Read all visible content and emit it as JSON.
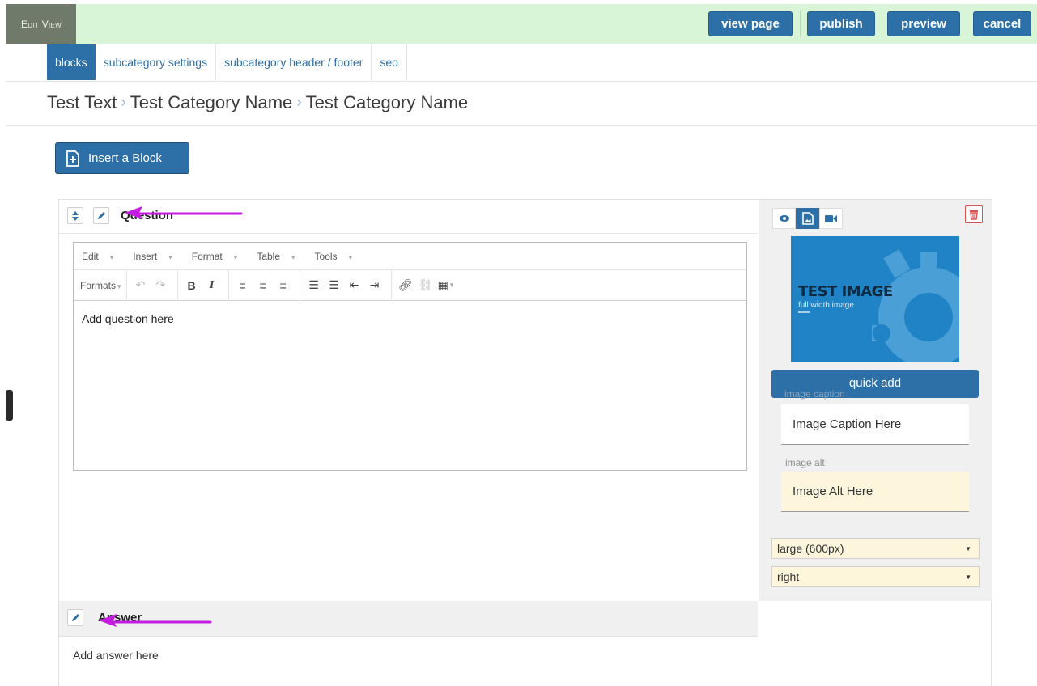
{
  "topbar": {
    "edit_view": "Edit View",
    "view_page": "view page",
    "publish": "publish",
    "preview": "preview",
    "cancel": "cancel"
  },
  "tabs": [
    "blocks",
    "subcategory settings",
    "subcategory header / footer",
    "seo"
  ],
  "breadcrumb": [
    "Test Text",
    "Test Category Name",
    "Test Category Name"
  ],
  "insert_block": "Insert a Block",
  "question": {
    "title": "Question",
    "menu": [
      "Edit",
      "Insert",
      "Format",
      "Table",
      "Tools"
    ],
    "formats": "Formats",
    "content": "Add question here"
  },
  "side": {
    "thumb_title": "TEST IMAGE",
    "thumb_sub": "full width image",
    "quick_add": "quick add",
    "caption_label": "image caption",
    "caption_value": "Image Caption Here",
    "alt_label": "image alt",
    "alt_value": "Image Alt Here",
    "size_select": "large (600px)",
    "align_select": "right"
  },
  "answer": {
    "title": "Answer",
    "content": "Add answer here"
  },
  "colors": {
    "accent": "#2d6fa7",
    "topbar_bg": "#d9f5d8",
    "annotation_arrow": "#c41de0",
    "alt_field_bg": "#fdf6dd"
  }
}
